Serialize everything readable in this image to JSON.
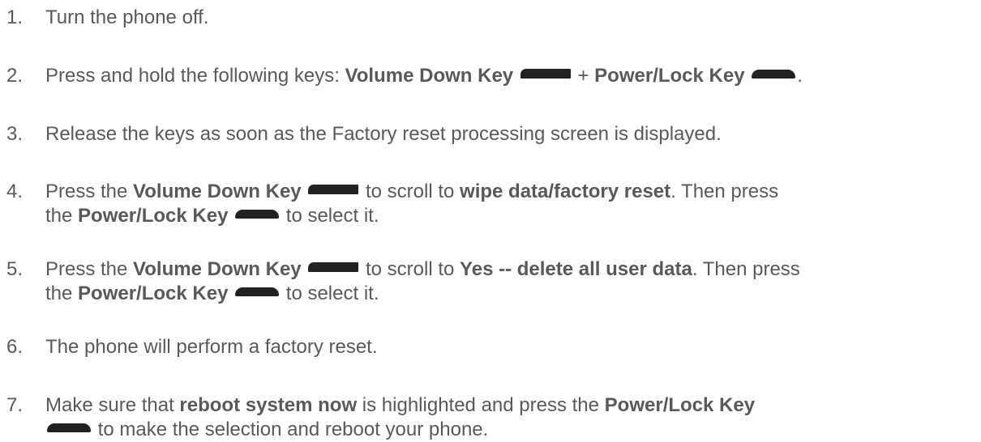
{
  "steps": [
    {
      "number": "1.",
      "text": "Turn the phone off."
    },
    {
      "number": "2.",
      "t1": "Press and hold the following keys: ",
      "b1": "Volume Down Key",
      "t2": " + ",
      "b2": "Power/Lock Key",
      "t3": "."
    },
    {
      "number": "3.",
      "text": "Release the keys as soon as the Factory reset processing screen is displayed."
    },
    {
      "number": "4.",
      "t1": "Press the ",
      "b1": "Volume Down Key",
      "t2": " to scroll to ",
      "b2": "wipe data/factory reset",
      "t3": ". Then press",
      "t4": "the ",
      "b3": "Power/Lock Key",
      "t5": " to select it."
    },
    {
      "number": "5.",
      "t1": "Press the ",
      "b1": "Volume Down Key",
      "t2": " to scroll to ",
      "b2": "Yes -- delete all user data",
      "t3": ". Then press",
      "t4": "the ",
      "b3": "Power/Lock Key",
      "t5": " to select it."
    },
    {
      "number": "6.",
      "text": "The phone will perform a factory reset."
    },
    {
      "number": "7.",
      "t1": "Make sure that ",
      "b1": "reboot system now",
      "t2": " is highlighted and press the ",
      "b2": "Power/Lock Key",
      "t3": " to make the selection and reboot your phone."
    }
  ],
  "icons": {
    "volume_key": "volume-down-key-icon",
    "power_key": "power-lock-key-icon",
    "key_color": "#222222"
  },
  "colors": {
    "text": "#595959",
    "background": "#ffffff"
  }
}
